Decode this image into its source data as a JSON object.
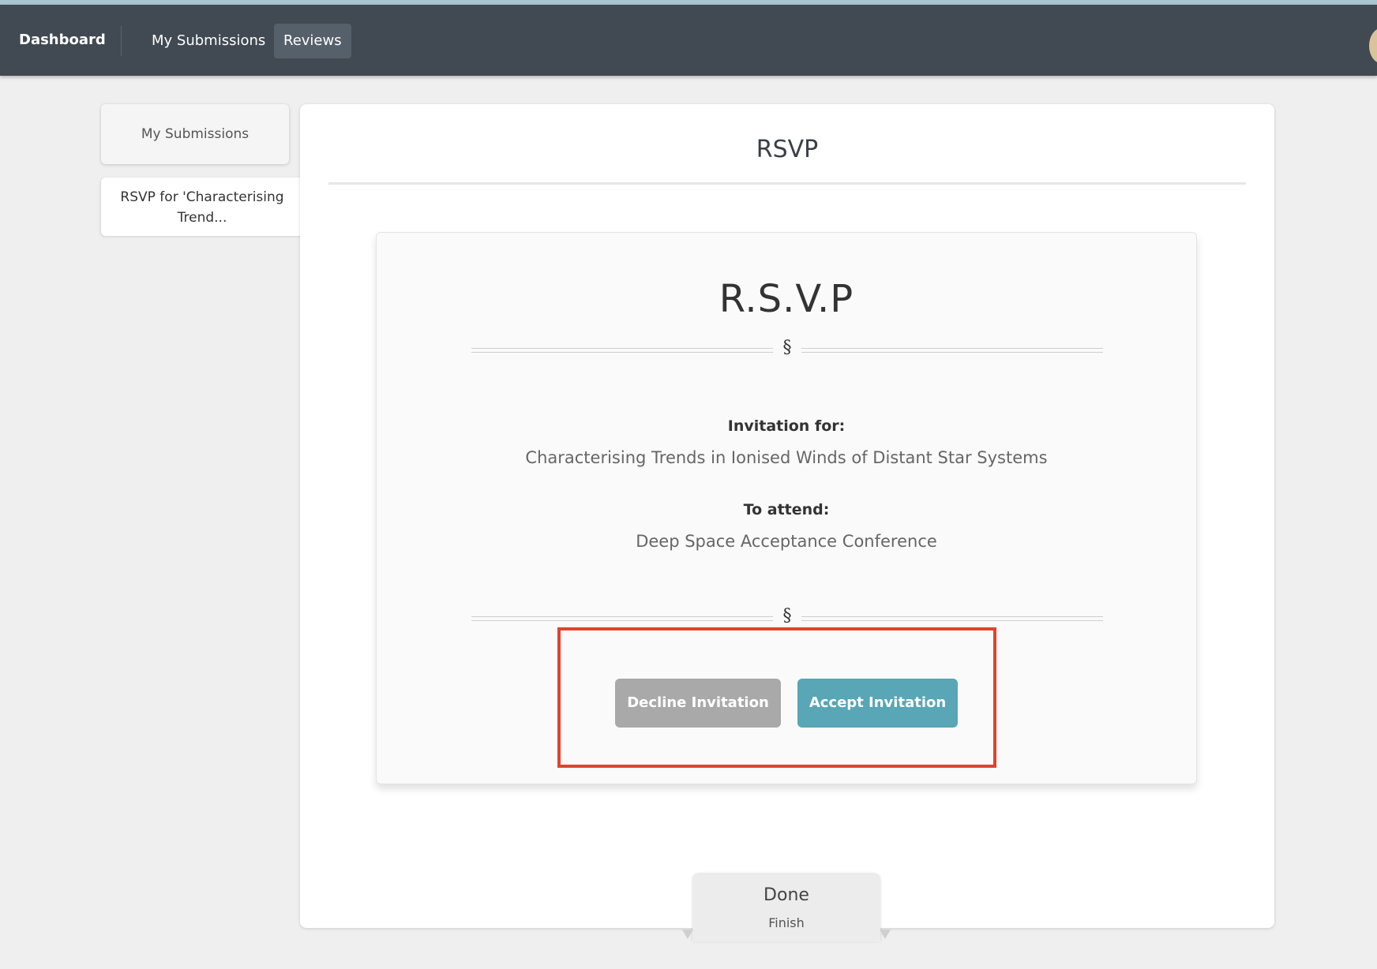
{
  "nav": {
    "brand": "Dashboard",
    "items": [
      {
        "label": "My Submissions"
      },
      {
        "label": "Reviews",
        "active": true
      }
    ]
  },
  "sidebar": {
    "items": [
      {
        "label": "My Submissions"
      },
      {
        "label": "RSVP for 'Characterising Trend..."
      }
    ]
  },
  "main": {
    "title": "RSVP",
    "card": {
      "heading": "R.S.V.P",
      "divider_symbol": "§",
      "invitation_label": "Invitation for:",
      "invitation_value": "Characterising Trends in Ionised Winds of Distant Star Systems",
      "attend_label": "To attend:",
      "attend_value": "Deep Space Acceptance Conference",
      "decline_label": "Decline Invitation",
      "accept_label": "Accept Invitation"
    }
  },
  "footer_tab": {
    "title": "Done",
    "subtitle": "Finish"
  },
  "colors": {
    "navbar": "#414a52",
    "accept": "#58a6b6",
    "decline": "#a9a9a9",
    "highlight": "#e0432e"
  }
}
